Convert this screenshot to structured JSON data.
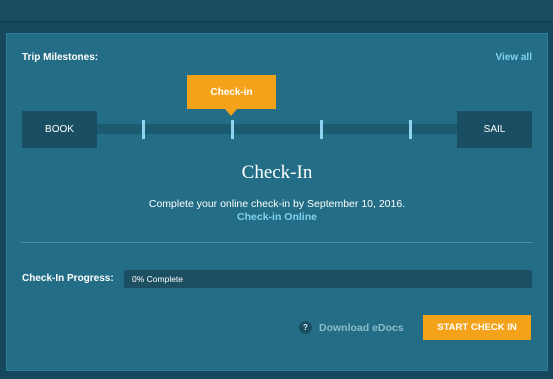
{
  "milestones": {
    "label": "Trip Milestones:",
    "view_all": "View all",
    "start_label": "BOOK",
    "end_label": "SAIL",
    "active_label": "Check-in"
  },
  "section": {
    "title": "Check-In",
    "deadline_text": "Complete your online check-in by September 10, 2016.",
    "link_text": "Check-in Online"
  },
  "progress": {
    "label": "Check-In Progress:",
    "value_percent": 0,
    "text": "0% Complete"
  },
  "actions": {
    "help_icon": "?",
    "download_label": "Download eDocs",
    "start_button": "START CHECK IN"
  },
  "colors": {
    "accent": "#f3a21a",
    "link": "#7fd2f0",
    "panel": "#236e86",
    "background": "#15485d"
  }
}
